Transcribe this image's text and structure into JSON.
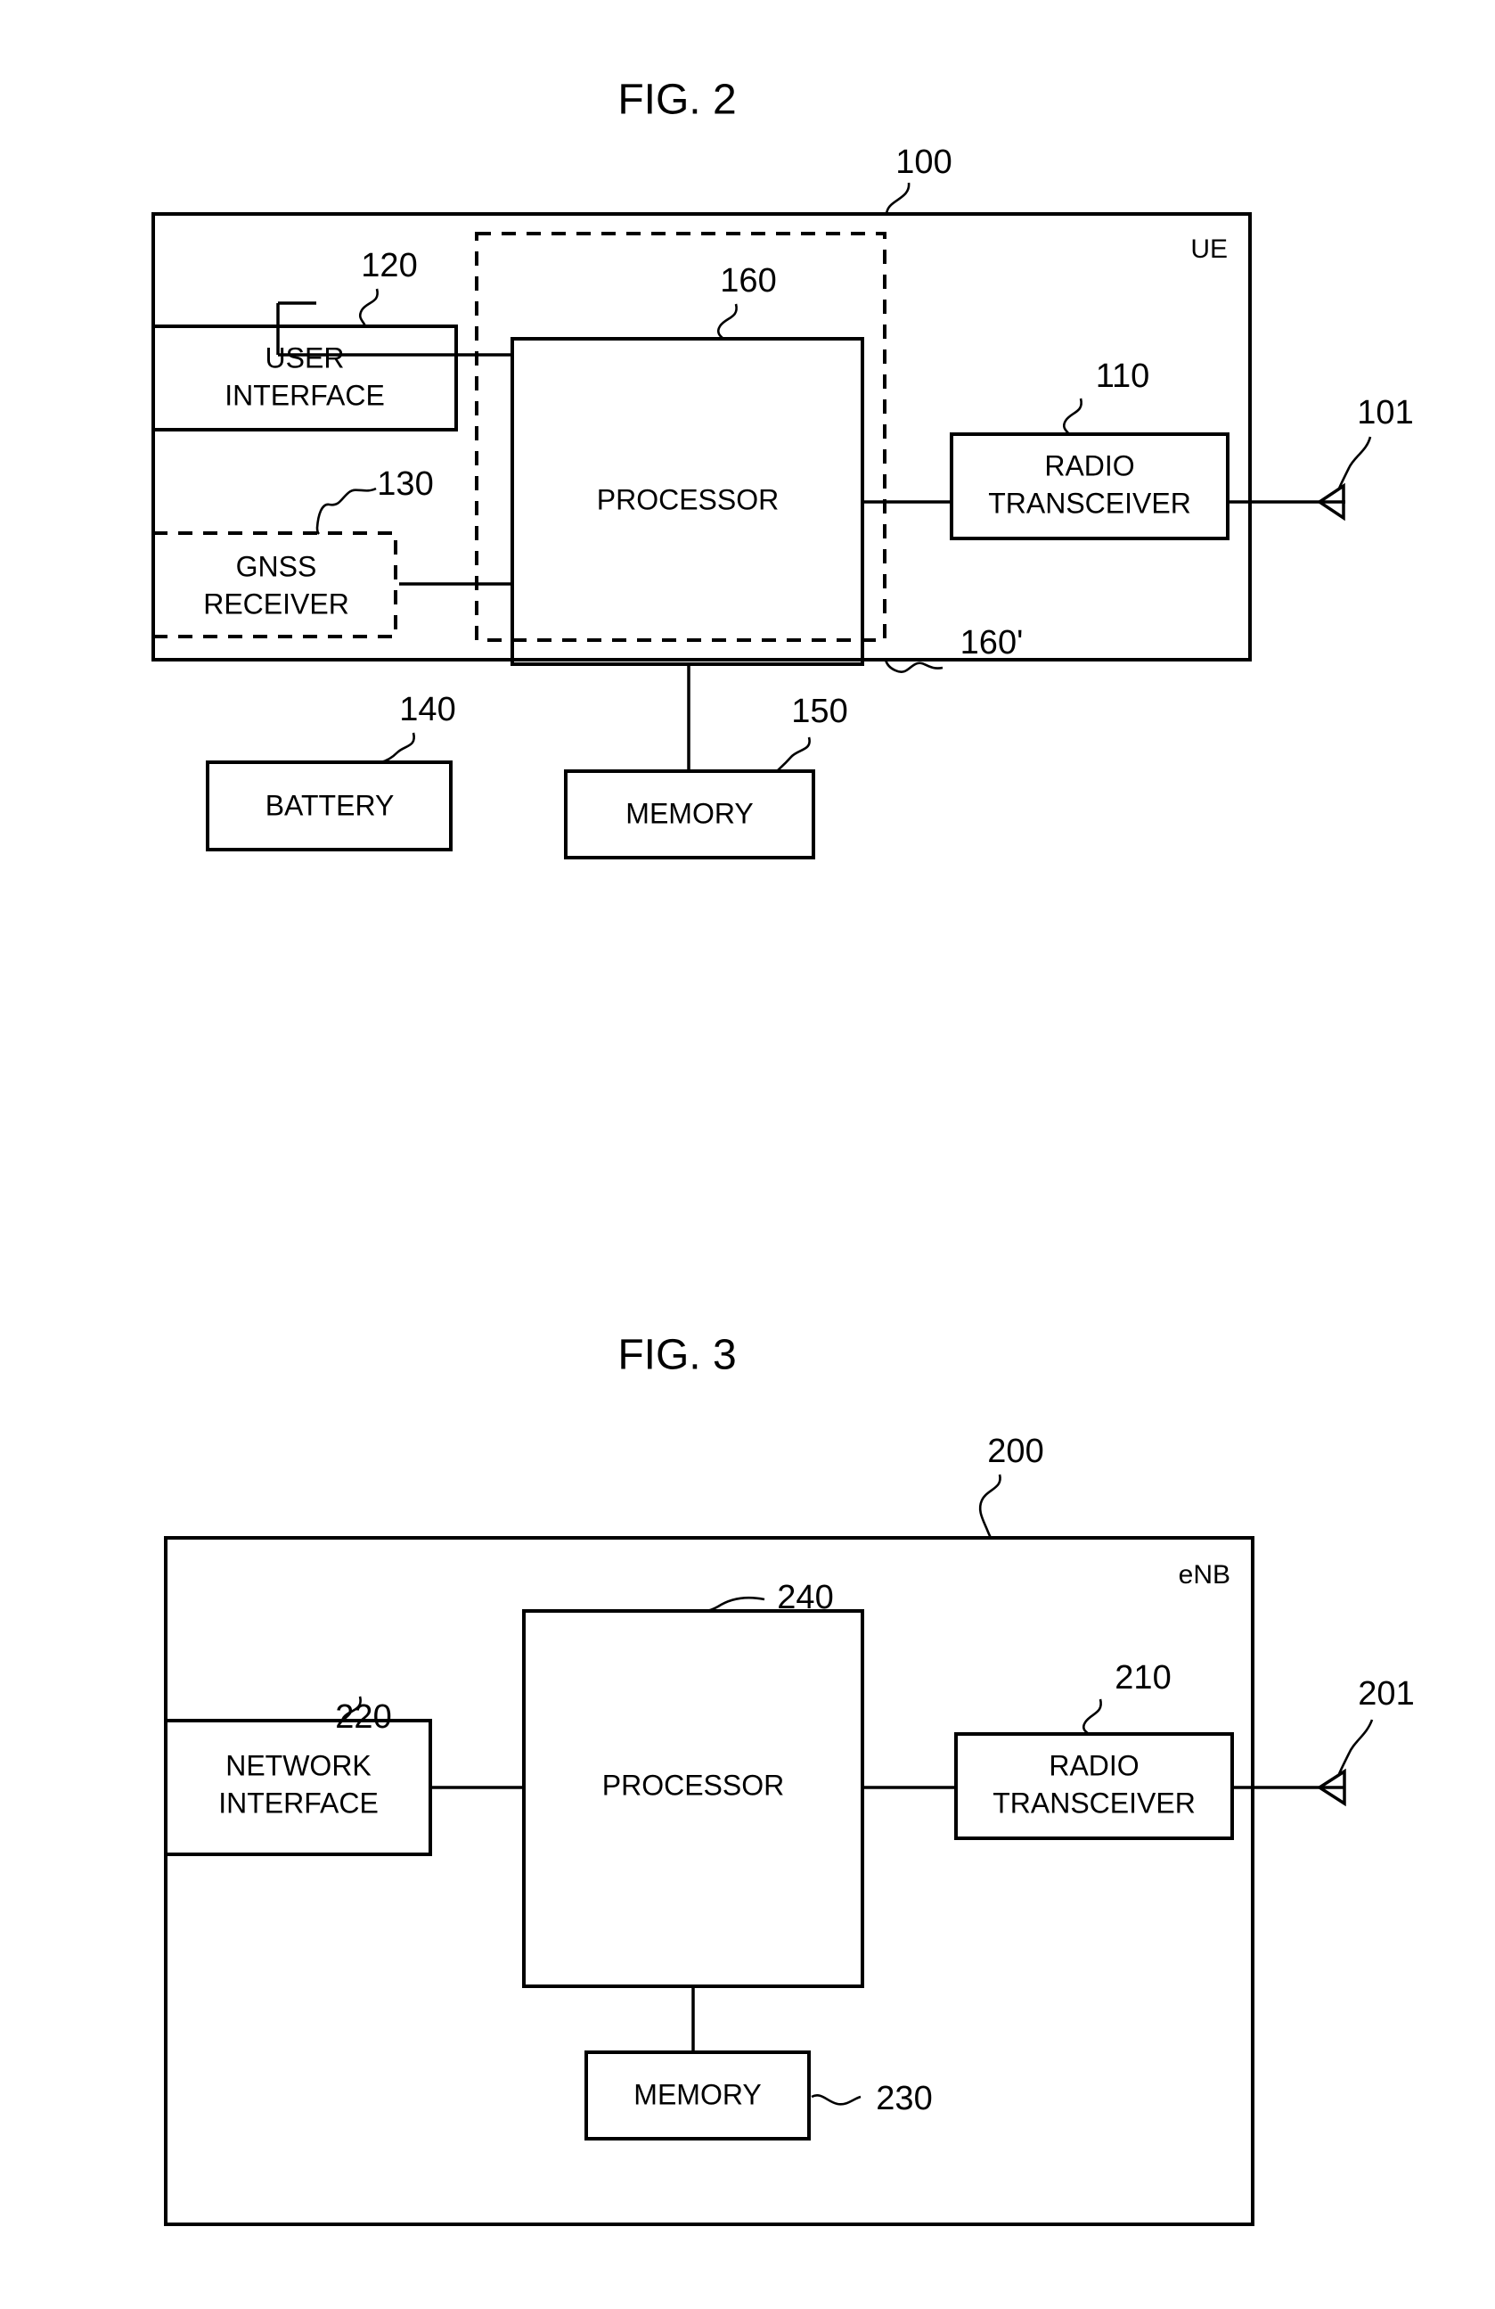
{
  "sheet": {
    "background_color": "#ffffff",
    "line_color": "#000000"
  },
  "figures": [
    {
      "id": "fig2",
      "title": "FIG. 2",
      "outer_ref": "100",
      "corner_label": "UE",
      "dashed_group_ref": "160'",
      "blocks": [
        {
          "key": "user_interface",
          "label_line1": "USER",
          "label_line2": "INTERFACE",
          "ref": "120",
          "style": "solid"
        },
        {
          "key": "gnss_receiver",
          "label_line1": "GNSS",
          "label_line2": "RECEIVER",
          "ref": "130",
          "style": "dashed"
        },
        {
          "key": "battery",
          "label_line1": "BATTERY",
          "label_line2": "",
          "ref": "140",
          "style": "solid"
        },
        {
          "key": "processor",
          "label_line1": "PROCESSOR",
          "label_line2": "",
          "ref": "160",
          "style": "solid"
        },
        {
          "key": "memory",
          "label_line1": "MEMORY",
          "label_line2": "",
          "ref": "150",
          "style": "solid"
        },
        {
          "key": "radio_transceiver",
          "label_line1": "RADIO",
          "label_line2": "TRANSCEIVER",
          "ref": "110",
          "style": "solid"
        }
      ],
      "antenna_ref": "101"
    },
    {
      "id": "fig3",
      "title": "FIG. 3",
      "outer_ref": "200",
      "corner_label": "eNB",
      "blocks": [
        {
          "key": "network_interface",
          "label_line1": "NETWORK",
          "label_line2": "INTERFACE",
          "ref": "220",
          "style": "solid"
        },
        {
          "key": "processor",
          "label_line1": "PROCESSOR",
          "label_line2": "",
          "ref": "240",
          "style": "solid"
        },
        {
          "key": "memory",
          "label_line1": "MEMORY",
          "label_line2": "",
          "ref": "230",
          "style": "solid"
        },
        {
          "key": "radio_transceiver",
          "label_line1": "RADIO",
          "label_line2": "TRANSCEIVER",
          "ref": "210",
          "style": "solid"
        }
      ],
      "antenna_ref": "201"
    }
  ]
}
